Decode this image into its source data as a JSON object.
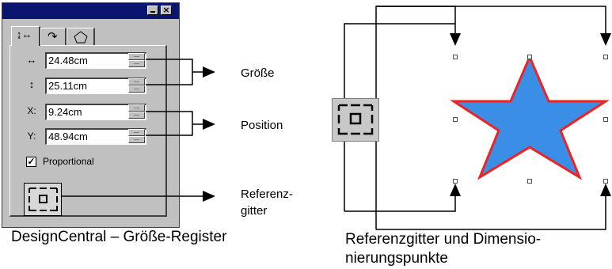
{
  "palette": {
    "tabs": [
      {
        "name": "tab-size-position",
        "icon": "size-position-icon"
      },
      {
        "name": "tab-rotate",
        "icon": "rotate-icon"
      },
      {
        "name": "tab-shape",
        "icon": "pentagon-icon"
      }
    ],
    "fields": {
      "width": {
        "icon": "↔",
        "value": "24.48cm"
      },
      "height": {
        "icon": "↕",
        "value": "25.11cm"
      },
      "x": {
        "icon": "X:",
        "value": "9.24cm"
      },
      "y": {
        "icon": "Y:",
        "value": "48.94cm"
      }
    },
    "proportional": {
      "label": "Proportional",
      "checked": true
    },
    "reference_grid_button": {
      "icon": "reference-grid-icon"
    }
  },
  "annotations": {
    "size": "Größe",
    "position": "Position",
    "reference_grid_line1": "Referenz-",
    "reference_grid_line2": "gitter"
  },
  "captions": {
    "left": "DesignCentral – Größe-Register",
    "right": "Referenzgitter und Dimensio-nierungspunkte"
  },
  "colors": {
    "title_bar": "#0a1570",
    "star_fill": "#3b8ee6",
    "star_outline": "#ee2222"
  }
}
